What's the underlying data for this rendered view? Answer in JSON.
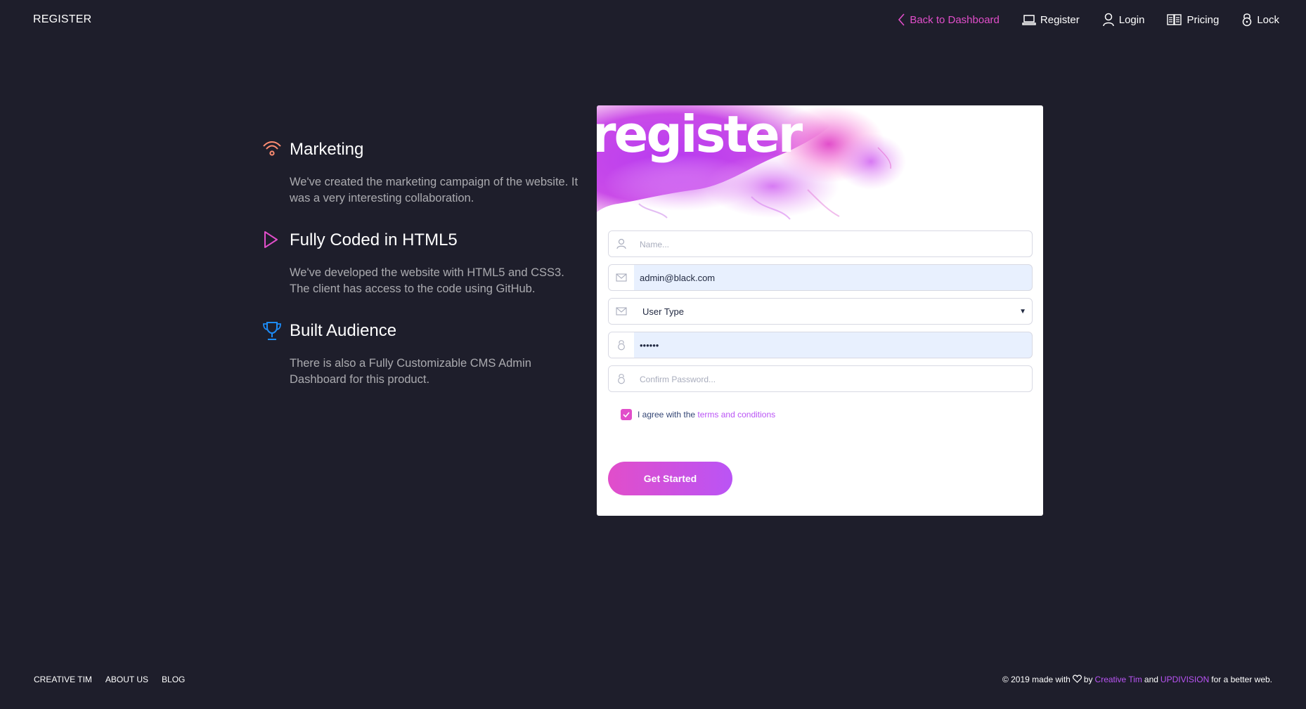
{
  "navbar": {
    "brand": "REGISTER",
    "items": [
      {
        "label": "Back to Dashboard",
        "icon": "chevron-left-icon"
      },
      {
        "label": "Register",
        "icon": "laptop-icon"
      },
      {
        "label": "Login",
        "icon": "user-icon"
      },
      {
        "label": "Pricing",
        "icon": "money-icon"
      },
      {
        "label": "Lock",
        "icon": "lock-icon"
      }
    ]
  },
  "info": [
    {
      "title": "Marketing",
      "text": "We've created the marketing campaign of the website. It was a very interesting collaboration.",
      "icon": "wifi-icon",
      "color": "#ff8d72"
    },
    {
      "title": "Fully Coded in HTML5",
      "text": "We've developed the website with HTML5 and CSS3. The client has access to the code using GitHub.",
      "icon": "play-icon",
      "color": "#e14eca"
    },
    {
      "title": "Built Audience",
      "text": "There is also a Fully Customizable CMS Admin Dashboard for this product.",
      "icon": "trophy-icon",
      "color": "#1d8cf8"
    }
  ],
  "card": {
    "title": "register",
    "name_placeholder": "Name...",
    "email_value": "admin@black.com",
    "user_type": "User Type",
    "password_value": "••••••",
    "confirm_placeholder": "Confirm Password...",
    "agree_text": "I agree with the",
    "terms_link": "terms and conditions",
    "agree_checked": true,
    "submit_label": "Get Started"
  },
  "footer": {
    "links": [
      "CREATIVE TIM",
      "ABOUT US",
      "BLOG"
    ],
    "copyright_prefix": "© 2019 made with",
    "by": "by",
    "creative_tim": "Creative Tim",
    "and": "and",
    "updivision": "UPDIVISION",
    "suffix": "for a better web."
  },
  "colors": {
    "background": "#1e1e2b",
    "primary": "#e14eca",
    "secondary": "#ba54f5"
  }
}
